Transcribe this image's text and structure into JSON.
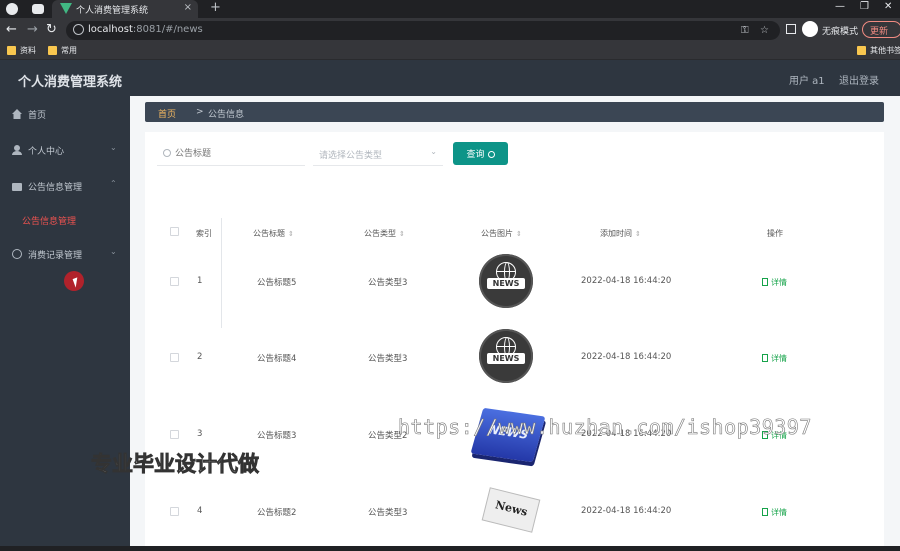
{
  "browser": {
    "tab_title": "个人消费管理系统",
    "tab_close": "×",
    "new_tab": "+",
    "url_host": "localhost",
    "url_rest": ":8081/#/news",
    "incognito_label": "无痕模式",
    "update_label": "更新",
    "bookmarks": [
      "资料",
      "常用",
      "其他书签"
    ]
  },
  "app": {
    "title": "个人消费管理系统",
    "user_label": "用户 a1",
    "logout": "退出登录"
  },
  "sidebar": {
    "items": [
      {
        "label": "首页",
        "icon": "home-icon"
      },
      {
        "label": "个人中心",
        "icon": "user-icon",
        "arrow": "⌄"
      },
      {
        "label": "公告信息管理",
        "icon": "briefcase-icon",
        "arrow": "⌃"
      },
      {
        "label": "消费记录管理",
        "icon": "clock-icon",
        "arrow": "⌄"
      }
    ],
    "sub_item": "公告信息管理"
  },
  "breadcrumb": {
    "home": "首页",
    "sep": ">",
    "current": "公告信息"
  },
  "search": {
    "title_placeholder": "公告标题",
    "type_placeholder": "请选择公告类型",
    "query_button": "查询"
  },
  "table": {
    "headers": [
      "索引",
      "公告标题",
      "公告类型",
      "公告图片",
      "添加时间",
      "操作"
    ],
    "rows": [
      {
        "index": "1",
        "title": "公告标题5",
        "type": "公告类型3",
        "image": "news-dark",
        "time": "2022-04-18 16:44:20",
        "action": "详情"
      },
      {
        "index": "2",
        "title": "公告标题4",
        "type": "公告类型3",
        "image": "news-dark",
        "time": "2022-04-18 16:44:20",
        "action": "详情"
      },
      {
        "index": "3",
        "title": "公告标题3",
        "type": "公告类型2",
        "image": "news-blue",
        "time": "2022-04-18 16:44:20",
        "action": "详情"
      },
      {
        "index": "4",
        "title": "公告标题2",
        "type": "公告类型3",
        "image": "news-paper",
        "time": "2022-04-18 16:44:20",
        "action": "详情"
      }
    ],
    "news_text_upper": "NEWS",
    "news_text_paper": "News"
  },
  "watermark": {
    "url": "https://www.huzhan.com/ishop39397",
    "text": "专业毕业设计代做"
  }
}
